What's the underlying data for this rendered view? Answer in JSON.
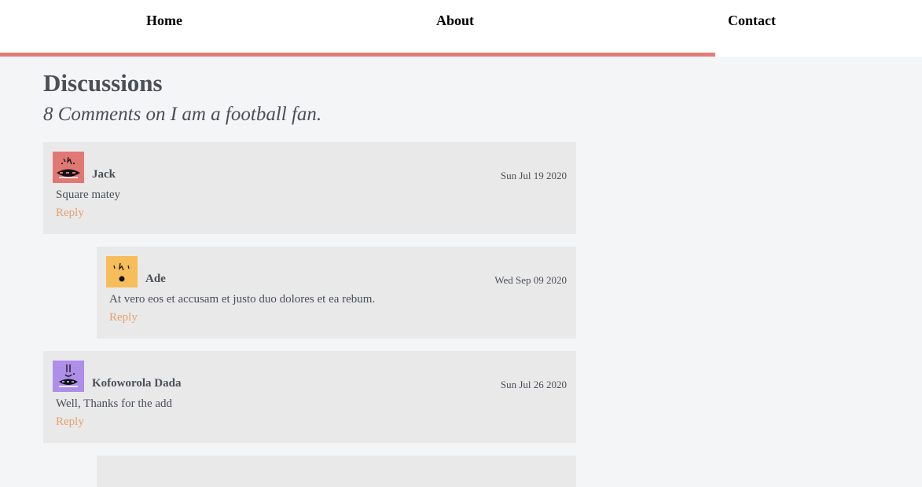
{
  "nav": {
    "items": [
      {
        "label": "Home"
      },
      {
        "label": "About"
      },
      {
        "label": "Contact"
      }
    ],
    "accent_color": "#e57b78"
  },
  "page": {
    "title": "Discussions",
    "subtitle": "8 Comments on I am a football fan."
  },
  "comments": [
    {
      "author": "Jack",
      "date": "Sun Jul 19 2020",
      "text": "Square matey",
      "reply_label": "Reply",
      "avatar_color": "#e07874",
      "avatar_icon": "robot-face-icon"
    },
    {
      "author": "Ade",
      "date": "Wed Sep 09 2020",
      "text": "At vero eos et accusam et justo duo dolores et ea rebum.",
      "reply_label": "Reply",
      "avatar_color": "#f7bd5a",
      "avatar_icon": "surprised-face-icon"
    },
    {
      "author": "Kofoworola Dada",
      "date": "Sun Jul 26 2020",
      "text": "Well, Thanks for the add",
      "reply_label": "Reply",
      "avatar_color": "#ad8ee8",
      "avatar_icon": "robot-face-icon"
    }
  ],
  "reply_color": "#e6a06a"
}
